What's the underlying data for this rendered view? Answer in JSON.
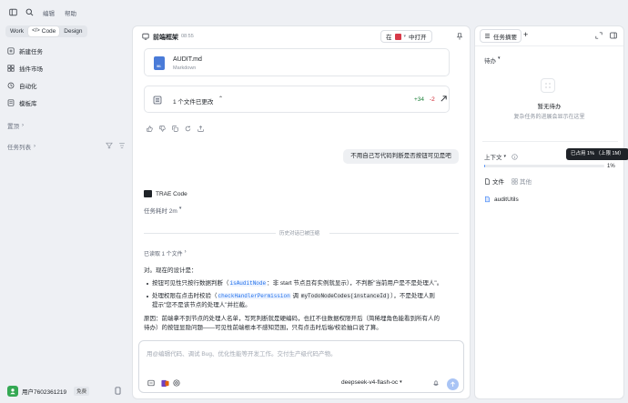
{
  "topbar": {
    "menu_edit": "编辑",
    "menu_help": "帮助"
  },
  "modes": [
    "Work",
    "Code",
    "Design"
  ],
  "sidebar": {
    "nav": [
      {
        "label": "新建任务",
        "icon": "new-task-icon"
      },
      {
        "label": "插件市场",
        "icon": "plugin-market-icon"
      },
      {
        "label": "自动化",
        "icon": "automation-icon"
      },
      {
        "label": "模板库",
        "icon": "template-library-icon"
      }
    ],
    "pinned_label": "置顶",
    "tasks_label": "任务列表",
    "user_name": "用户7602361219",
    "plan_badge": "免费"
  },
  "main": {
    "title": "前端框架",
    "time": "08:55",
    "open_in_prefix": "在",
    "open_in_suffix": "中打开",
    "file_card": {
      "name": "AUDIT.md",
      "type": "Markdown",
      "icon_text": "M↓"
    },
    "changes_card": {
      "label": "1 个文件已更改",
      "added": "+34",
      "removed": "-2"
    },
    "user_message": "不用自己写代码判断是否按钮可见是吧",
    "agent_name": "TRAE Code",
    "task_duration": "任务耗时 2m",
    "compressed_note": "历史对话已被压缩",
    "read_note": "已读取 1 个文件",
    "answer_intro": "对。现在的设计是：",
    "bullet1": {
      "pre": "按钮可见性只按行数据判断（",
      "code": "isAuditNode",
      "post": "：非 start 节点且有实例就显示），不判断\"当前用户是不是处理人\"。"
    },
    "bullet2": {
      "pre": "处理权限在点击时校验（",
      "code1": "checkHandlerPermission",
      "mid": " 调 ",
      "code2": "myTodoNodeCodes(instanceId)",
      "post_line1": "），不是处理人则",
      "line2": "提示\"您不是该节点的处理人\"并拦截。"
    },
    "reason": {
      "line1": "原因：前端拿不到节点的处理人名单，写死判断就是硬编码，也扛不住数据权限开后（简稀埋角色能看到所有人的",
      "line2": "待办）的按钮显隐问题——可见性前端根本不感知范围，只有点击时后端/校验抽口说了算。"
    },
    "input_placeholder": "用@编辑代码、调试 Bug、优化性能等开发工作。交付生产级代码产物。",
    "model_name": "deepseek-v4-flash-oc"
  },
  "right": {
    "tab_label": "任务摘要",
    "todo_label": "待办",
    "empty_title": "暂无待办",
    "empty_desc": "复杂任务的进展会显示在这里",
    "context_label": "上下文",
    "tooltip": "已占用 1% （上限 1M）",
    "context_percent": "1%",
    "context_usage": 0.01,
    "tabs": [
      "文件",
      "其他"
    ],
    "file_name": "auditUtils"
  },
  "colors": {
    "accent": "#1f6feb",
    "added": "#1a7f37",
    "removed": "#cf222e",
    "avatar": "#34a853"
  }
}
